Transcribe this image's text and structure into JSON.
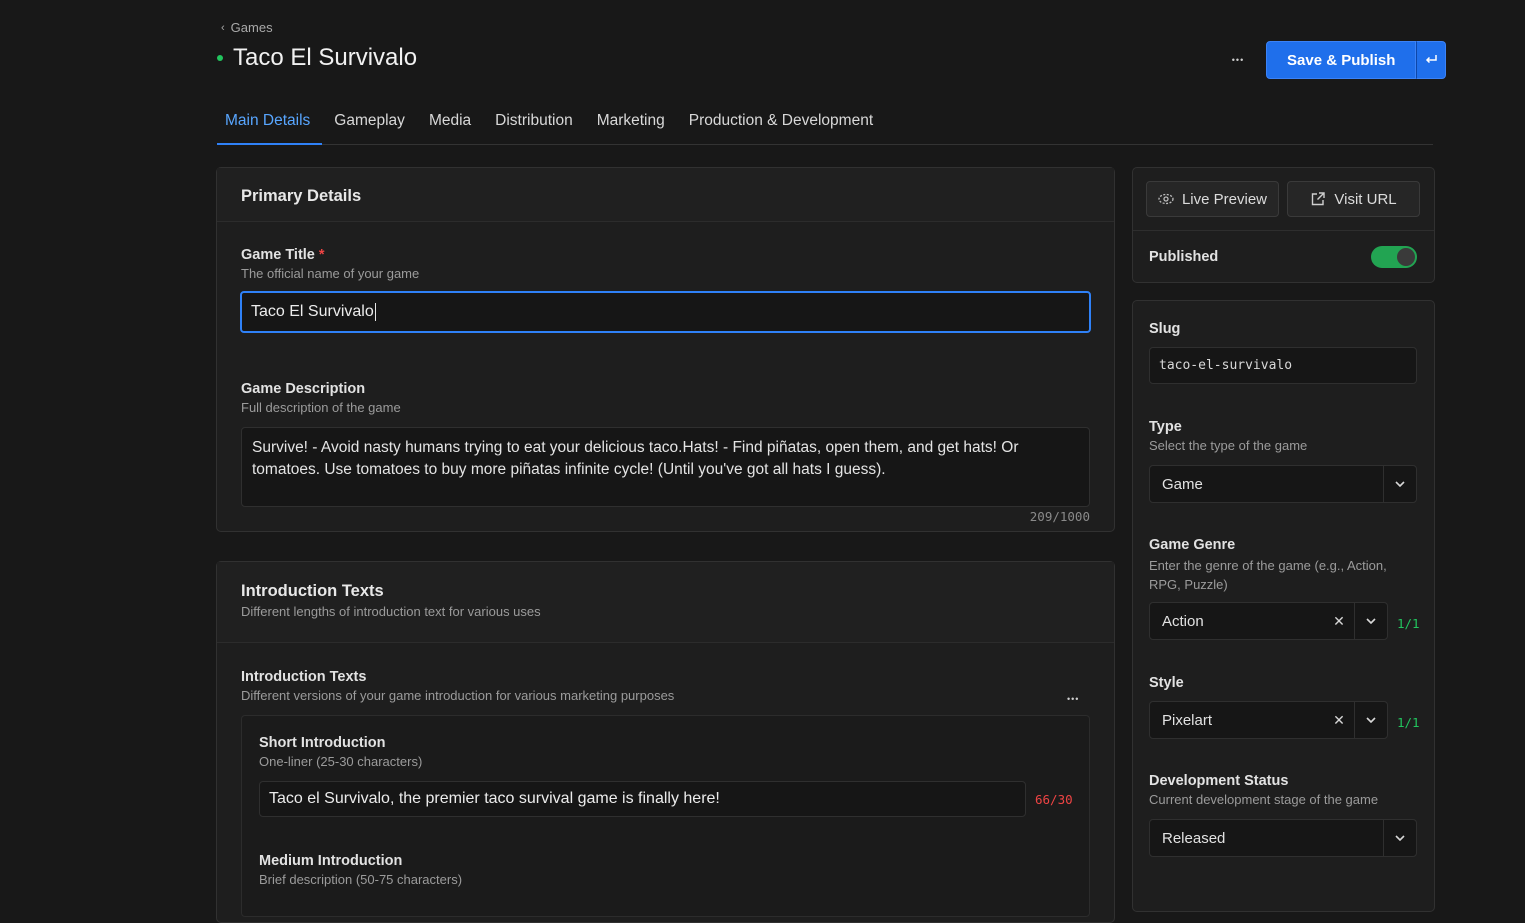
{
  "header": {
    "breadcrumb": "Games",
    "title": "Taco El Survivalo",
    "more_label": "•••",
    "publish_label": "Save & Publish"
  },
  "tabs": [
    {
      "label": "Main Details"
    },
    {
      "label": "Gameplay"
    },
    {
      "label": "Media"
    },
    {
      "label": "Distribution"
    },
    {
      "label": "Marketing"
    },
    {
      "label": "Production & Development"
    }
  ],
  "primary": {
    "heading": "Primary Details",
    "title_label": "Game Title",
    "required_mark": "*",
    "title_help": "The official name of your game",
    "title_value": "Taco El Survivalo",
    "desc_label": "Game Description",
    "desc_help": "Full description of the game",
    "desc_value": "Survive! - Avoid nasty humans trying to eat your delicious taco.Hats! - Find piñatas, open them, and get hats! Or tomatoes. Use tomatoes to buy more piñatas infinite cycle! (Until you've got all hats I guess).",
    "desc_counter": "209/1000"
  },
  "intro": {
    "heading": "Introduction Texts",
    "heading_help": "Different lengths of introduction text for various uses",
    "sub_label": "Introduction Texts",
    "sub_help": "Different versions of your game introduction for various marketing purposes",
    "more_label": "•••",
    "short_label": "Short Introduction",
    "short_help": "One-liner (25-30 characters)",
    "short_value": "Taco el Survivalo, the premier taco survival game is finally here!",
    "short_counter": "66/30",
    "medium_label": "Medium Introduction",
    "medium_help": "Brief description (50-75 characters)"
  },
  "side": {
    "live_preview": "Live Preview",
    "visit_url": "Visit URL",
    "published_label": "Published",
    "published": true,
    "slug_label": "Slug",
    "slug_value": "taco-el-survivalo",
    "type_label": "Type",
    "type_help": "Select the type of the game",
    "type_value": "Game",
    "genre_label": "Game Genre",
    "genre_help": "Enter the genre of the game (e.g., Action, RPG, Puzzle)",
    "genre_value": "Action",
    "genre_count": "1/1",
    "style_label": "Style",
    "style_value": "Pixelart",
    "style_count": "1/1",
    "dev_label": "Development Status",
    "dev_help": "Current development stage of the game",
    "dev_value": "Released"
  },
  "colors": {
    "accent": "#2f81f7",
    "status_green": "#22c55e",
    "error_red": "#ef4444"
  }
}
